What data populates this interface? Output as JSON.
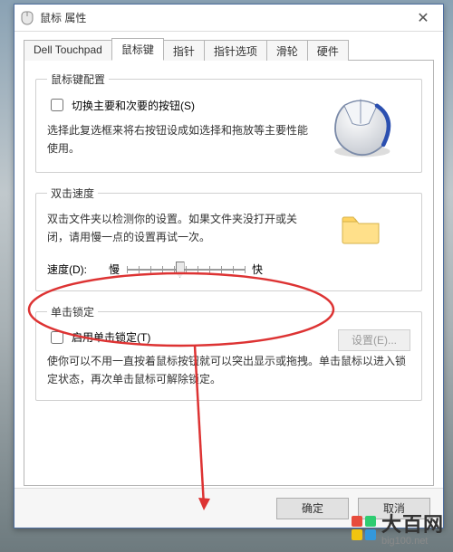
{
  "window": {
    "title": "鼠标 属性"
  },
  "tabs": [
    {
      "label": "Dell Touchpad"
    },
    {
      "label": "鼠标键"
    },
    {
      "label": "指针"
    },
    {
      "label": "指针选项"
    },
    {
      "label": "滑轮"
    },
    {
      "label": "硬件"
    }
  ],
  "active_tab_index": 1,
  "button_config": {
    "legend": "鼠标键配置",
    "checkbox_label": "切换主要和次要的按钮(S)",
    "checked": false,
    "desc": "选择此复选框来将右按钮设成如选择和拖放等主要性能使用。"
  },
  "double_click": {
    "legend": "双击速度",
    "desc": "双击文件夹以检测你的设置。如果文件夹没打开或关闭，请用慢一点的设置再试一次。",
    "speed_label": "速度(D):",
    "slow_label": "慢",
    "fast_label": "快",
    "slider_value_percent": 45
  },
  "click_lock": {
    "legend": "单击锁定",
    "checkbox_label": "启用单击锁定(T)",
    "checked": false,
    "settings_button_label": "设置(E)...",
    "settings_disabled": true,
    "desc": "使你可以不用一直按着鼠标按钮就可以突出显示或拖拽。单击鼠标以进入锁定状态，再次单击鼠标可解除锁定。"
  },
  "footer": {
    "ok_label": "确定",
    "cancel_label": "取消"
  },
  "watermark": {
    "brand": "大百网",
    "url": "big100.net",
    "logo_colors": [
      "#e74c3c",
      "#2ecc71",
      "#f1c40f",
      "#3498db"
    ]
  },
  "annotation": {
    "ellipse_stroke": "#d33",
    "arrow_stroke": "#d33"
  }
}
